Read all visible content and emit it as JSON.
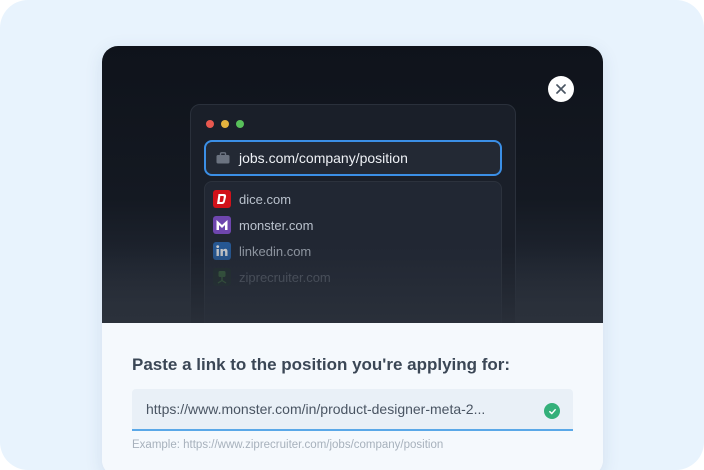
{
  "hero": {
    "url_bar": {
      "text": "jobs.com/company/position",
      "icon": "briefcase-icon"
    },
    "window_dots": [
      "#e8584f",
      "#e4b33e",
      "#58c05a"
    ],
    "suggestions": [
      {
        "name": "dice.com",
        "logo": "dice-logo",
        "color": "#d1121a",
        "opacity": 1
      },
      {
        "name": "monster.com",
        "logo": "monster-logo",
        "color": "#6e46ae",
        "opacity": 1
      },
      {
        "name": "linkedin.com",
        "logo": "linkedin-logo",
        "color": "#2867b2",
        "opacity": 0.75
      },
      {
        "name": "ziprecruiter.com",
        "logo": "ziprecruiter-logo",
        "color": "#4a9e3b",
        "opacity": 0.35
      }
    ],
    "close_icon": "close-icon"
  },
  "form": {
    "heading": "Paste a link to the position you're applying for:",
    "link_value": "https://www.monster.com/in/product-designer-meta-2...",
    "valid_icon": "check-circle-icon",
    "valid_color": "#34b07a",
    "example": "Example: https://www.ziprecruiter.com/jobs/company/position"
  }
}
